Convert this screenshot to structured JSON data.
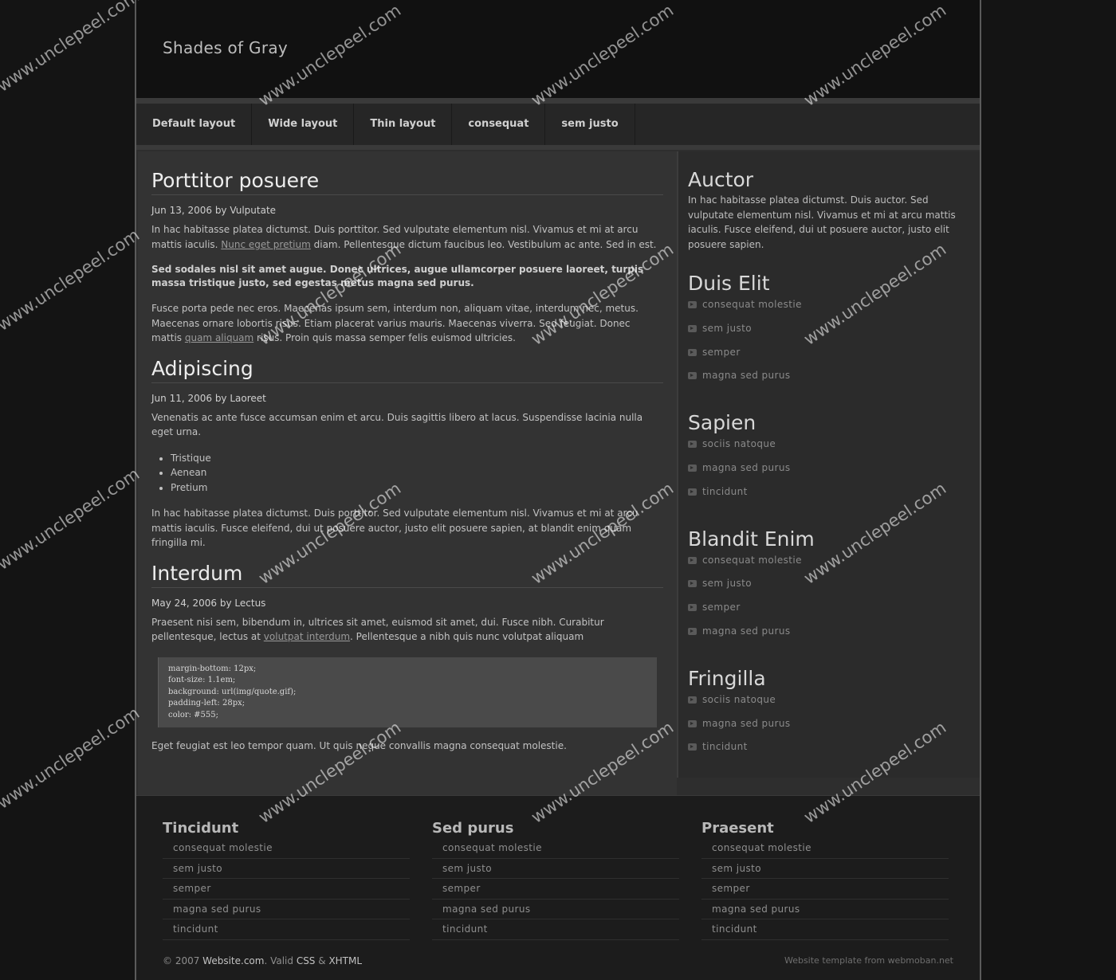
{
  "site_title": "Shades of Gray",
  "nav": [
    "Default layout",
    "Wide layout",
    "Thin layout",
    "consequat",
    "sem justo"
  ],
  "posts": [
    {
      "title": "Porttitor posuere",
      "meta": "Jun 13, 2006 by Vulputate",
      "p1_a": "In hac habitasse platea dictumst. Duis porttitor. Sed vulputate elementum nisl. Vivamus et mi at arcu mattis iaculis. ",
      "p1_link": "Nunc eget pretium",
      "p1_b": " diam. Pellentesque dictum faucibus leo. Vestibulum ac ante. Sed in est.",
      "p2": "Sed sodales nisl sit amet augue. Donec ultrices, augue ullamcorper posuere laoreet, turpis massa tristique justo, sed egestas metus magna sed purus.",
      "p3_a": "Fusce porta pede nec eros. Maecenas ipsum sem, interdum non, aliquam vitae, interdum nec, metus. Maecenas ornare lobortis risus. Etiam placerat varius mauris. Maecenas viverra. Sed feugiat. Donec mattis ",
      "p3_link": "quam aliquam",
      "p3_b": " risus. Proin quis massa semper felis euismod ultricies."
    },
    {
      "title": "Adipiscing",
      "meta": "Jun 11, 2006 by Laoreet",
      "p1": "Venenatis ac ante fusce accumsan enim et arcu. Duis sagittis libero at lacus. Suspendisse lacinia nulla eget urna.",
      "list": [
        "Tristique",
        "Aenean",
        "Pretium"
      ],
      "p2": "In hac habitasse platea dictumst. Duis porttitor. Sed vulputate elementum nisl. Vivamus et mi at arcu mattis iaculis. Fusce eleifend, dui ut posuere auctor, justo elit posuere sapien, at blandit enim quam fringilla mi."
    },
    {
      "title": "Interdum",
      "meta": "May 24, 2006 by Lectus",
      "p1_a": "Praesent nisi sem, bibendum in, ultrices sit amet, euismod sit amet, dui. Fusce nibh. Curabitur pellentesque, lectus at ",
      "p1_link": "volutpat interdum",
      "p1_b": ". Pellentesque a nibh quis nunc volutpat aliquam",
      "code": "margin-bottom: 12px;\nfont-size: 1.1em;\nbackground: url(img/quote.gif);\npadding-left: 28px;\ncolor: #555;",
      "p2": "Eget feugiat est leo tempor quam. Ut quis neque convallis magna consequat molestie."
    }
  ],
  "sidebar": {
    "auctor_title": "Auctor",
    "auctor_text": "In hac habitasse platea dictumst. Duis auctor. Sed vulputate elementum nisl. Vivamus et mi at arcu mattis iaculis. Fusce eleifend, dui ut posuere auctor, justo elit posuere sapien.",
    "blocks": [
      {
        "title": "Duis Elit",
        "items": [
          "consequat molestie",
          "sem justo",
          "semper",
          "magna sed purus"
        ]
      },
      {
        "title": "Sapien",
        "items": [
          "sociis natoque",
          "magna sed purus",
          "tincidunt"
        ]
      },
      {
        "title": "Blandit Enim",
        "items": [
          "consequat molestie",
          "sem justo",
          "semper",
          "magna sed purus"
        ]
      },
      {
        "title": "Fringilla",
        "items": [
          "sociis natoque",
          "magna sed purus",
          "tincidunt"
        ]
      }
    ]
  },
  "footer": {
    "columns": [
      {
        "title": "Tincidunt",
        "items": [
          "consequat molestie",
          "sem justo",
          "semper",
          "magna sed purus",
          "tincidunt"
        ]
      },
      {
        "title": "Sed purus",
        "items": [
          "consequat molestie",
          "sem justo",
          "semper",
          "magna sed purus",
          "tincidunt"
        ]
      },
      {
        "title": "Praesent",
        "items": [
          "consequat molestie",
          "sem justo",
          "semper",
          "magna sed purus",
          "tincidunt"
        ]
      }
    ],
    "copy_prefix": "© 2007 ",
    "copy_site": "Website.com",
    "copy_mid": ". Valid ",
    "copy_css": "CSS",
    "copy_amp": " & ",
    "copy_xhtml": "XHTML",
    "credit": "Website template from webmoban.net"
  },
  "watermark": "www.unclepeel.com"
}
